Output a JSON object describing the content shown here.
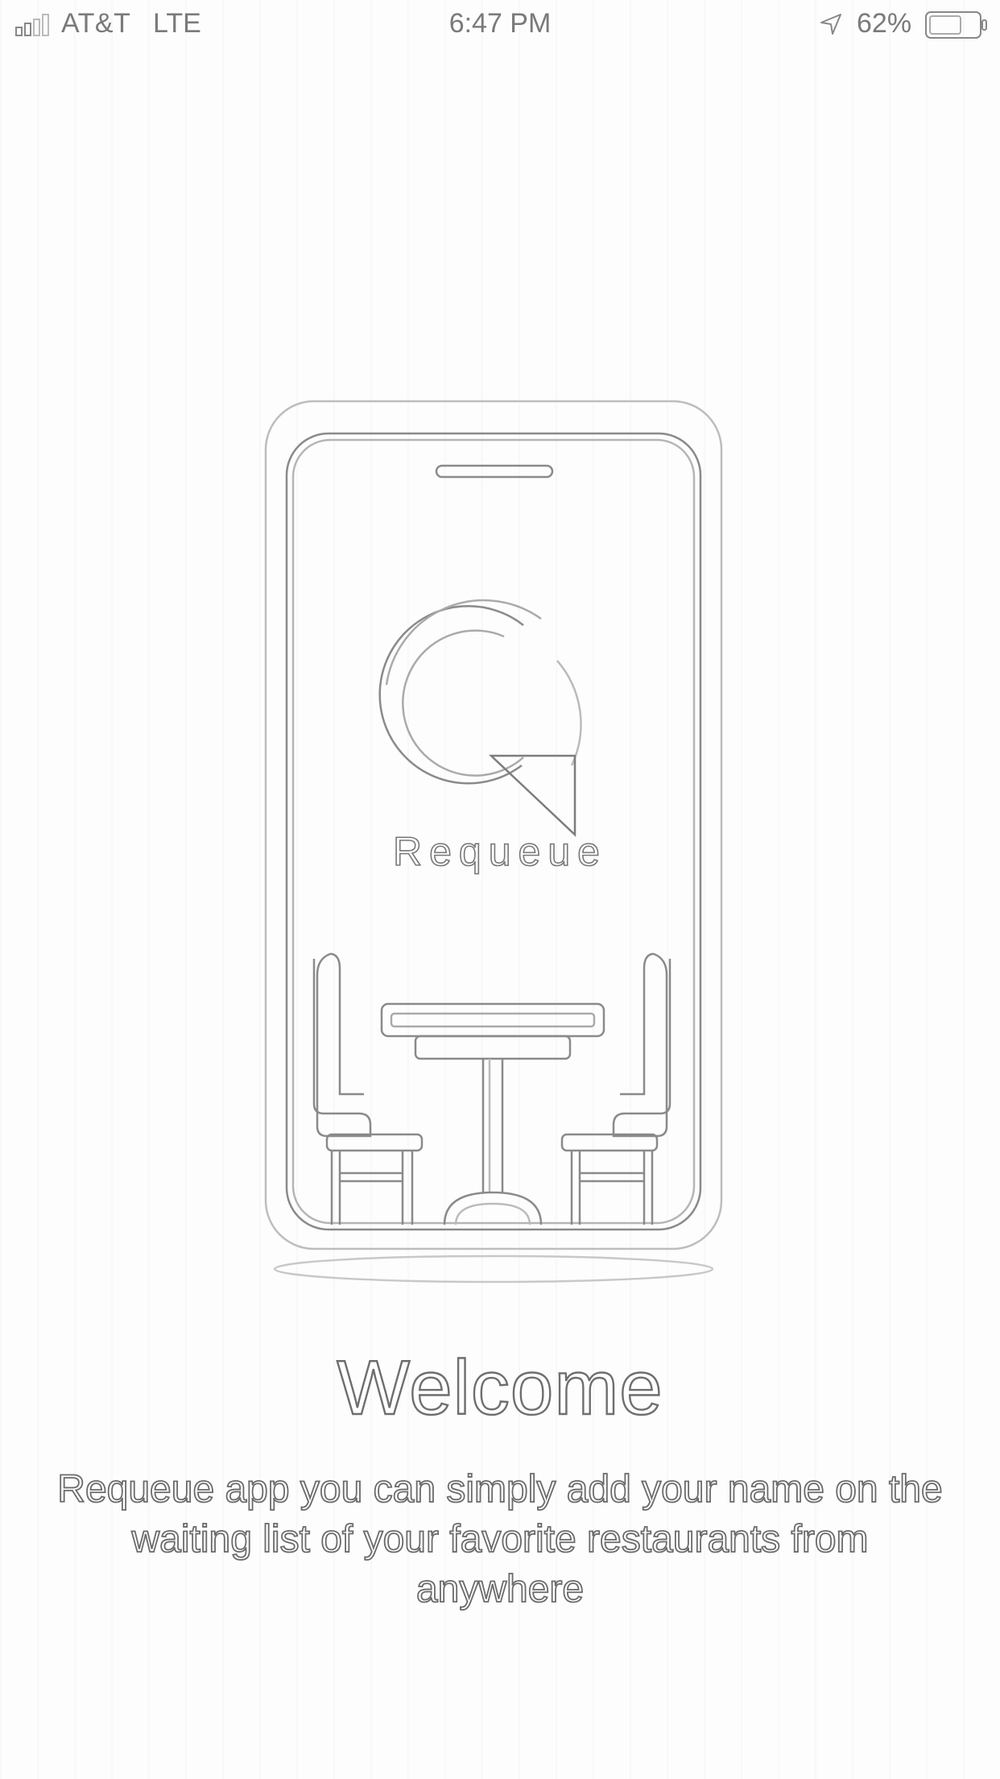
{
  "status_bar": {
    "carrier": "AT&T",
    "network": "LTE",
    "time": "6:47 PM",
    "battery_percent": "62%",
    "icons": [
      "signal-icon",
      "location-arrow-icon",
      "battery-icon"
    ]
  },
  "illustration": {
    "brand_name": "Requeue",
    "icons": [
      "phone-frame-icon",
      "requeue-logo-icon",
      "table-and-chairs-icon"
    ]
  },
  "welcome": {
    "title": "Welcome",
    "body": "Requeue app you can simply add your name on the waiting list of your favorite restaurants from anywhere"
  },
  "colors": {
    "background": "#fdfdfd",
    "outline": "#777777"
  }
}
